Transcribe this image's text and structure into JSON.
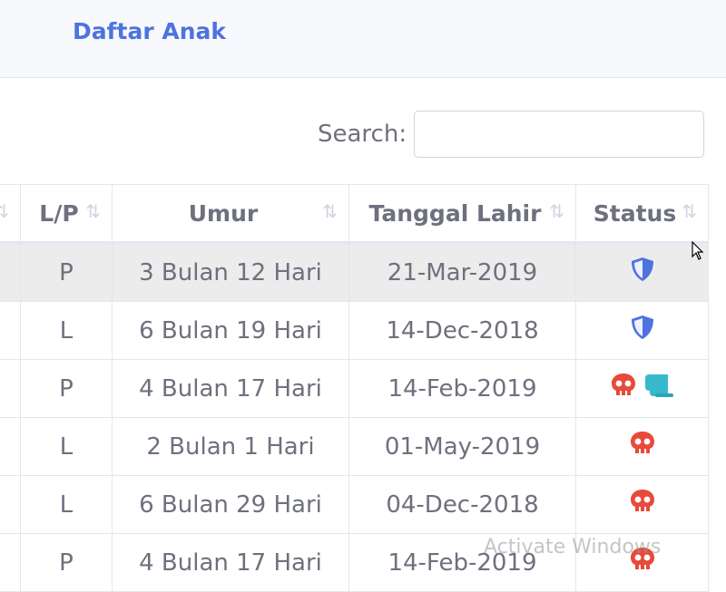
{
  "header": {
    "title": "Daftar Anak"
  },
  "search": {
    "label": "Search:",
    "value": ""
  },
  "table": {
    "columns": [
      "",
      "L/P",
      "Umur",
      "Tanggal Lahir",
      "Status"
    ],
    "rows": [
      {
        "lp": "P",
        "umur": "3 Bulan 12 Hari",
        "tanggal_lahir": "21-Mar-2019",
        "status_icons": [
          "shield-icon"
        ]
      },
      {
        "lp": "L",
        "umur": "6 Bulan 19 Hari",
        "tanggal_lahir": "14-Dec-2018",
        "status_icons": [
          "shield-icon"
        ]
      },
      {
        "lp": "P",
        "umur": "4 Bulan 17 Hari",
        "tanggal_lahir": "14-Feb-2019",
        "status_icons": [
          "skull-icon",
          "scroll-icon"
        ]
      },
      {
        "lp": "L",
        "umur": "2 Bulan 1 Hari",
        "tanggal_lahir": "01-May-2019",
        "status_icons": [
          "skull-icon"
        ]
      },
      {
        "lp": "L",
        "umur": "6 Bulan 29 Hari",
        "tanggal_lahir": "04-Dec-2018",
        "status_icons": [
          "skull-icon"
        ]
      },
      {
        "lp": "P",
        "umur": "4 Bulan 17 Hari",
        "tanggal_lahir": "14-Feb-2019",
        "status_icons": [
          "skull-icon"
        ]
      }
    ]
  },
  "watermark": "Activate Windows",
  "colors": {
    "accent": "#4e73df",
    "danger": "#e74a3b",
    "info": "#36b9cc"
  }
}
